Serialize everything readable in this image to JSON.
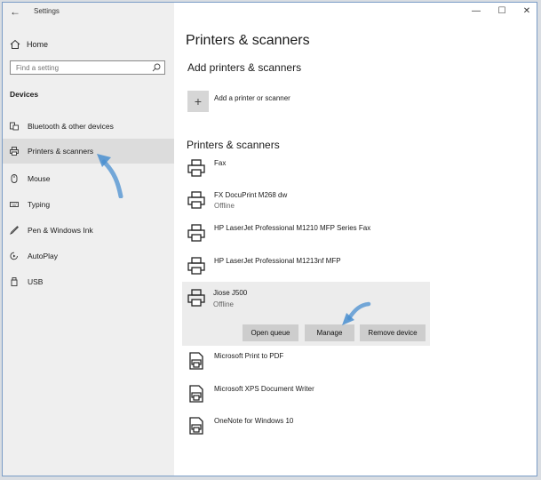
{
  "window": {
    "title": "Settings",
    "controls": {
      "back": "←",
      "minimize": "—",
      "maximize": "☐",
      "close": "✕"
    }
  },
  "sidebar": {
    "home_label": "Home",
    "search_placeholder": "Find a setting",
    "section": "Devices",
    "items": [
      {
        "label": "Bluetooth & other devices",
        "icon": "keyboard-icon"
      },
      {
        "label": "Printers & scanners",
        "icon": "printer-icon",
        "selected": true
      },
      {
        "label": "Mouse",
        "icon": "mouse-icon"
      },
      {
        "label": "Typing",
        "icon": "keyboard-small-icon"
      },
      {
        "label": "Pen & Windows Ink",
        "icon": "pen-icon"
      },
      {
        "label": "AutoPlay",
        "icon": "autoplay-icon"
      },
      {
        "label": "USB",
        "icon": "usb-icon"
      }
    ]
  },
  "main": {
    "title": "Printers & scanners",
    "add_section": "Add printers & scanners",
    "add_label": "Add a printer or scanner",
    "list_section": "Printers & scanners",
    "printers": [
      {
        "name": "Fax",
        "status": ""
      },
      {
        "name": "FX DocuPrint M268 dw",
        "status": "Offline"
      },
      {
        "name": "HP LaserJet Professional M1210 MFP Series Fax",
        "status": ""
      },
      {
        "name": "HP LaserJet Professional M1213nf MFP",
        "status": ""
      },
      {
        "name": "Jiose J500",
        "status": "Offline",
        "selected": true
      },
      {
        "name": "Microsoft Print to PDF",
        "status": ""
      },
      {
        "name": "Microsoft XPS Document Writer",
        "status": ""
      },
      {
        "name": "OneNote for Windows 10",
        "status": ""
      }
    ],
    "buttons": {
      "open_queue": "Open queue",
      "manage": "Manage",
      "remove": "Remove device"
    }
  },
  "colors": {
    "accent": "#4a8fd0",
    "sidebar_bg": "#efefef",
    "selected_bg": "#dcdcdc"
  }
}
